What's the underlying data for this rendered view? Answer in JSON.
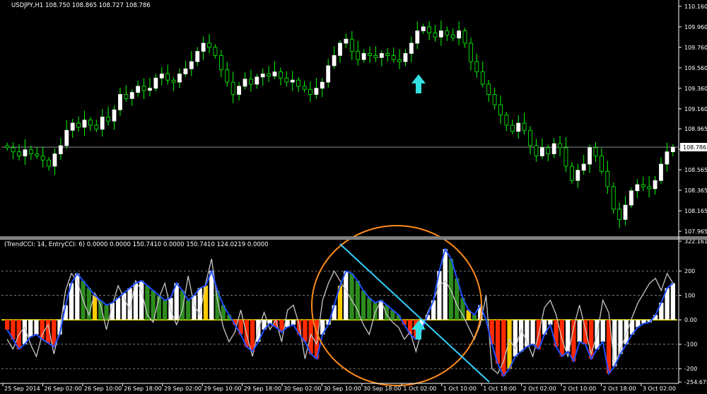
{
  "window": {
    "symbol_line": "USDJPY,H1  108.750 108.865 108.727 108.786",
    "indicator_line": "(TrendCCI: 14, EntryCCI: 6)  0.0000 0.0000 150.7410 0.0000 150.7410 124.0219 0.0000"
  },
  "colors": {
    "background": "#000000",
    "bull_candle": "#ffffff",
    "bear_candle": "#00ff00",
    "wick": "#00ff00",
    "price_line": "#c0c0c0",
    "panel_separator": "#808080",
    "hist_green": "#2e8b1e",
    "hist_red": "#ff2a00",
    "hist_white": "#ffffff",
    "hist_yellow": "#ffcc00",
    "trend_cci_line": "#2050ff",
    "entry_cci_line": "#c8c8c8",
    "zero_line": "#ffff00",
    "arrow": "#33e0e0",
    "annotation_ellipse": "#ff8c1a",
    "annotation_trendline": "#33d0ff"
  },
  "price_axis": {
    "labels": [
      "110.160",
      "109.960",
      "109.760",
      "109.560",
      "109.360",
      "109.160",
      "108.965",
      "108.765",
      "108.565",
      "108.365",
      "108.165",
      "107.965"
    ],
    "current_price": "108.786"
  },
  "indicator_axis": {
    "labels": [
      "322.1615",
      "200",
      "100",
      "0.00",
      "-100",
      "-200",
      "-254.675"
    ]
  },
  "time_axis": {
    "labels": [
      "25 Sep 2014",
      "26 Sep 02:00",
      "26 Sep 10:00",
      "26 Sep 18:00",
      "29 Sep 02:00",
      "29 Sep 10:00",
      "29 Sep 18:00",
      "30 Sep 02:00",
      "30 Sep 10:00",
      "30 Sep 18:00",
      "1 Oct 02:00",
      "1 Oct 10:00",
      "1 Oct 18:00",
      "2 Oct 02:00",
      "2 Oct 10:00",
      "2 Oct 18:00",
      "3 Oct 02:00"
    ]
  },
  "chart_data": [
    {
      "type": "candlestick",
      "title": "USDJPY,H1  108.750 108.865 108.727 108.786",
      "ylim": [
        107.93,
        110.18
      ],
      "current_price": 108.786,
      "closes": [
        108.78,
        108.74,
        108.7,
        108.76,
        108.72,
        108.7,
        108.66,
        108.6,
        108.72,
        108.8,
        108.95,
        109.02,
        108.98,
        109.05,
        109.0,
        108.96,
        109.08,
        109.04,
        109.15,
        109.3,
        109.26,
        109.32,
        109.38,
        109.34,
        109.36,
        109.46,
        109.5,
        109.44,
        109.42,
        109.5,
        109.55,
        109.62,
        109.72,
        109.8,
        109.76,
        109.68,
        109.54,
        109.42,
        109.3,
        109.38,
        109.45,
        109.4,
        109.47,
        109.5,
        109.48,
        109.52,
        109.46,
        109.42,
        109.44,
        109.38,
        109.35,
        109.3,
        109.36,
        109.42,
        109.58,
        109.68,
        109.8,
        109.84,
        109.72,
        109.64,
        109.7,
        109.68,
        109.66,
        109.7,
        109.68,
        109.64,
        109.62,
        109.7,
        109.8,
        109.92,
        109.96,
        109.9,
        109.86,
        109.92,
        109.88,
        109.85,
        109.92,
        109.8,
        109.62,
        109.52,
        109.4,
        109.3,
        109.2,
        109.1,
        109.0,
        108.94,
        109.02,
        108.95,
        108.8,
        108.7,
        108.78,
        108.72,
        108.82,
        108.78,
        108.6,
        108.46,
        108.56,
        108.62,
        108.78,
        108.7,
        108.55,
        108.4,
        108.18,
        108.08,
        108.22,
        108.36,
        108.42,
        108.4,
        108.38,
        108.46,
        108.62,
        108.74,
        108.786
      ]
    },
    {
      "type": "histogram",
      "title": "(TrendCCI: 14, EntryCCI: 6)  0.0000 0.0000 150.7410 0.0000 150.7410 124.0219 0.0000",
      "ylim": [
        -254.675,
        322.1615
      ],
      "series": [
        {
          "name": "TrendCCI",
          "values": [
            -40,
            -80,
            -120,
            -100,
            -70,
            -60,
            -80,
            -95,
            -110,
            -60,
            60,
            150,
            190,
            160,
            130,
            100,
            80,
            60,
            70,
            90,
            110,
            130,
            150,
            160,
            140,
            120,
            100,
            80,
            90,
            150,
            120,
            80,
            100,
            130,
            140,
            200,
            120,
            60,
            20,
            -20,
            -60,
            -110,
            -130,
            -90,
            -40,
            -15,
            -30,
            -50,
            -30,
            -20,
            -60,
            -90,
            -140,
            -160,
            -60,
            -20,
            60,
            140,
            200,
            190,
            160,
            120,
            90,
            70,
            80,
            60,
            40,
            20,
            -20,
            -60,
            -80,
            -40,
            20,
            80,
            200,
            290,
            250,
            170,
            90,
            40,
            20,
            60,
            0,
            -100,
            -180,
            -230,
            -200,
            -150,
            -130,
            -110,
            -100,
            -120,
            -60,
            -20,
            -110,
            -150,
            -130,
            -170,
            -90,
            -100,
            -160,
            -120,
            -90,
            -220,
            -190,
            -140,
            -100,
            -60,
            -30,
            -15,
            -10,
            20,
            70,
            130,
            150
          ]
        },
        {
          "name": "EntryCCI",
          "values": [
            -80,
            -120,
            -60,
            -30,
            -100,
            -150,
            -60,
            -20,
            -140,
            -40,
            120,
            190,
            160,
            80,
            20,
            110,
            60,
            -40,
            60,
            140,
            90,
            40,
            160,
            120,
            20,
            -10,
            90,
            150,
            40,
            -20,
            40,
            180,
            60,
            20,
            150,
            250,
            80,
            -30,
            -90,
            -50,
            40,
            -60,
            -150,
            -40,
            30,
            -40,
            0,
            -90,
            40,
            60,
            -20,
            -160,
            -60,
            -100,
            80,
            150,
            200,
            160,
            120,
            80,
            40,
            -20,
            -60,
            30,
            80,
            20,
            -10,
            -30,
            -80,
            -50,
            -130,
            -40,
            30,
            80,
            140,
            160,
            120,
            60,
            20,
            -30,
            -80,
            -20,
            100,
            -200,
            -220,
            -170,
            -80,
            -120,
            -40,
            -90,
            -150,
            -60,
            50,
            80,
            20,
            -80,
            -150,
            -30,
            60,
            -40,
            -140,
            -60,
            80,
            30,
            -190,
            -120,
            -60,
            10,
            70,
            110,
            150,
            170,
            120,
            190,
            150
          ]
        }
      ]
    }
  ]
}
